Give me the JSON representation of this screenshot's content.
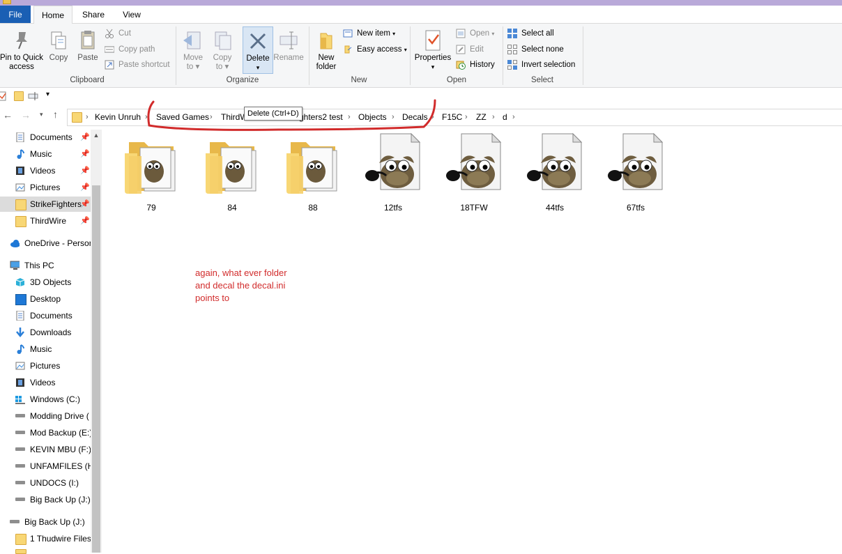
{
  "ribbon": {
    "tabs": [
      "File",
      "Home",
      "Share",
      "View"
    ],
    "clipboard": {
      "pin_label_1": "Pin to Quick",
      "pin_label_2": "access",
      "copy": "Copy",
      "paste": "Paste",
      "cut": "Cut",
      "copy_path": "Copy path",
      "paste_shortcut": "Paste shortcut",
      "group": "Clipboard"
    },
    "organize": {
      "move_1": "Move",
      "move_2": "to",
      "copy_1": "Copy",
      "copy_2": "to",
      "delete": "Delete",
      "rename": "Rename",
      "group": "Organize"
    },
    "new": {
      "new_folder_1": "New",
      "new_folder_2": "folder",
      "new_item": "New item",
      "easy_access": "Easy access",
      "group": "New"
    },
    "open": {
      "properties": "Properties",
      "open": "Open",
      "edit": "Edit",
      "history": "History",
      "group": "Open"
    },
    "select": {
      "select_all": "Select all",
      "select_none": "Select none",
      "invert": "Invert selection",
      "group": "Select"
    }
  },
  "tooltip": "Delete (Ctrl+D)",
  "breadcrumb": [
    "Kevin Unruh",
    "Saved Games",
    "ThirdW",
    "ghters2 test",
    "Objects",
    "Decals",
    "F15C",
    "ZZ",
    "d"
  ],
  "annotation": "again, what ever folder and decal the decal.ini points to",
  "nav": {
    "quick": [
      {
        "label": "Documents",
        "icon": "documents-icon",
        "pinned": true
      },
      {
        "label": "Music",
        "icon": "music-icon",
        "pinned": true
      },
      {
        "label": "Videos",
        "icon": "videos-icon",
        "pinned": true
      },
      {
        "label": "Pictures",
        "icon": "pictures-icon",
        "pinned": true
      },
      {
        "label": "StrikeFighters",
        "icon": "folder-icon",
        "pinned": true
      },
      {
        "label": "ThirdWire",
        "icon": "folder-icon",
        "pinned": true
      }
    ],
    "onedrive": "OneDrive - Persor",
    "thispc": "This PC",
    "pc_items": [
      {
        "label": "3D Objects",
        "icon": "3d-objects-icon"
      },
      {
        "label": "Desktop",
        "icon": "desktop-icon"
      },
      {
        "label": "Documents",
        "icon": "documents-icon"
      },
      {
        "label": "Downloads",
        "icon": "downloads-icon"
      },
      {
        "label": "Music",
        "icon": "music-icon"
      },
      {
        "label": "Pictures",
        "icon": "pictures-icon"
      },
      {
        "label": "Videos",
        "icon": "videos-icon"
      },
      {
        "label": "Windows (C:)",
        "icon": "windows-drive-icon"
      },
      {
        "label": "Modding Drive (",
        "icon": "drive-icon"
      },
      {
        "label": "Mod Backup (E:)",
        "icon": "drive-icon"
      },
      {
        "label": "KEVIN MBU (F:)",
        "icon": "drive-icon"
      },
      {
        "label": "UNFAMFILES (H:",
        "icon": "drive-icon"
      },
      {
        "label": "UNDOCS (I:)",
        "icon": "drive-icon"
      },
      {
        "label": "Big Back Up (J:)",
        "icon": "drive-icon"
      }
    ],
    "bigbackup": "Big Back Up (J:)",
    "thudwire": "1 Thudwire Files"
  },
  "files": [
    {
      "name": "79",
      "type": "folder"
    },
    {
      "name": "84",
      "type": "folder"
    },
    {
      "name": "88",
      "type": "folder"
    },
    {
      "name": "12tfs",
      "type": "gimp-file"
    },
    {
      "name": "18TFW",
      "type": "gimp-file"
    },
    {
      "name": "44tfs",
      "type": "gimp-file"
    },
    {
      "name": "67tfs",
      "type": "gimp-file"
    }
  ],
  "colors": {
    "file_tab": "#1a5fb4",
    "annotation_red": "#d12b2b",
    "selected_nav": "#dcdcdc"
  }
}
